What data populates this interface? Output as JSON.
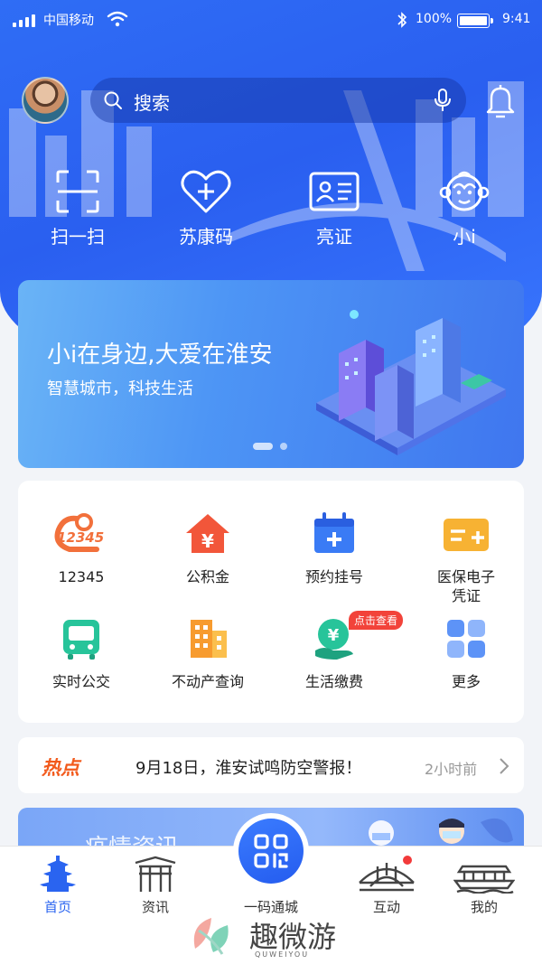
{
  "status_bar": {
    "carrier": "中国移动",
    "battery": "100%",
    "time": "9:41"
  },
  "search": {
    "label": "搜索"
  },
  "quick_actions": [
    {
      "label": "扫一扫",
      "icon": "scan-icon"
    },
    {
      "label": "苏康码",
      "icon": "heart-plus-icon"
    },
    {
      "label": "亮证",
      "icon": "id-card-icon"
    },
    {
      "label": "小i",
      "icon": "monkey-icon"
    }
  ],
  "banner": {
    "title": "小i在身边,大爱在淮安",
    "subtitle": "智慧城市，科技生活",
    "page_count": 2,
    "active_index": 0
  },
  "services": [
    {
      "label": "12345",
      "icon": "hotline-12345-icon",
      "icon_text": "12345"
    },
    {
      "label": "公积金",
      "icon": "housing-fund-icon",
      "icon_text": "¥"
    },
    {
      "label": "预约挂号",
      "icon": "calendar-plus-icon"
    },
    {
      "label": "医保电子凭证",
      "icon": "medical-card-icon"
    },
    {
      "label": "实时公交",
      "icon": "bus-icon"
    },
    {
      "label": "不动产查询",
      "icon": "building-icon"
    },
    {
      "label": "生活缴费",
      "icon": "payment-icon",
      "icon_text": "¥",
      "badge": "点击查看"
    },
    {
      "label": "更多",
      "icon": "grid-more-icon"
    }
  ],
  "hot": {
    "tag": "热点",
    "text": "9月18日，淮安试鸣防空警报！",
    "time": "2小时前"
  },
  "promo": {
    "text": "疫情资讯"
  },
  "tabbar": [
    {
      "label": "首页",
      "icon": "pagoda-icon",
      "active": true
    },
    {
      "label": "资讯",
      "icon": "archway-icon",
      "active": false
    },
    {
      "label": "一码通城",
      "icon": "qr-code-icon",
      "active": false
    },
    {
      "label": "互动",
      "icon": "bridge-icon",
      "active": false
    },
    {
      "label": "我的",
      "icon": "boat-icon",
      "active": false
    }
  ],
  "watermark": {
    "title": "趣微游",
    "subtitle": "QUWEIYOU"
  },
  "colors": {
    "primary": "#2a64f0",
    "hot": "#f25a1c",
    "badge": "#f2433a"
  }
}
